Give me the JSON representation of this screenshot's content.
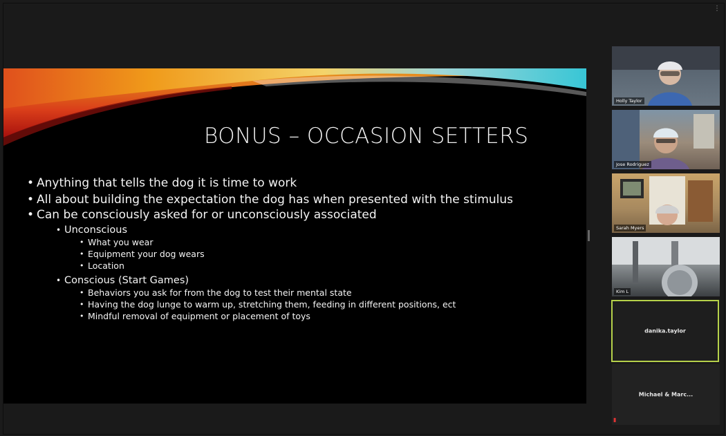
{
  "slide": {
    "title": "BONUS – OCCASION SETTERS",
    "bullets": {
      "b1": "Anything that tells the dog it is time to work",
      "b2": "All about building the expectation the dog has when presented with the stimulus",
      "b3": "Can be consciously asked for or unconsciously associated",
      "unconscious": "Unconscious",
      "u1": "What you wear",
      "u2": "Equipment your dog wears",
      "u3": "Location",
      "conscious": "Conscious (Start Games)",
      "c1": "Behaviors you ask for from the dog to test their mental state",
      "c2": "Having the dog lunge to warm up, stretching them, feeding in different positions, ect",
      "c3": "Mindful removal of equipment or placement of toys"
    }
  },
  "participants": [
    {
      "name": "Holly Taylor"
    },
    {
      "name": "Jose Rodriguez"
    },
    {
      "name": "Sarah Myers"
    },
    {
      "name": "Kim L"
    },
    {
      "name": "danika.taylor"
    },
    {
      "name": "Michael & Marc..."
    }
  ],
  "colors": {
    "active_speaker_border": "#b6d24a",
    "muted_icon": "#e03434"
  }
}
